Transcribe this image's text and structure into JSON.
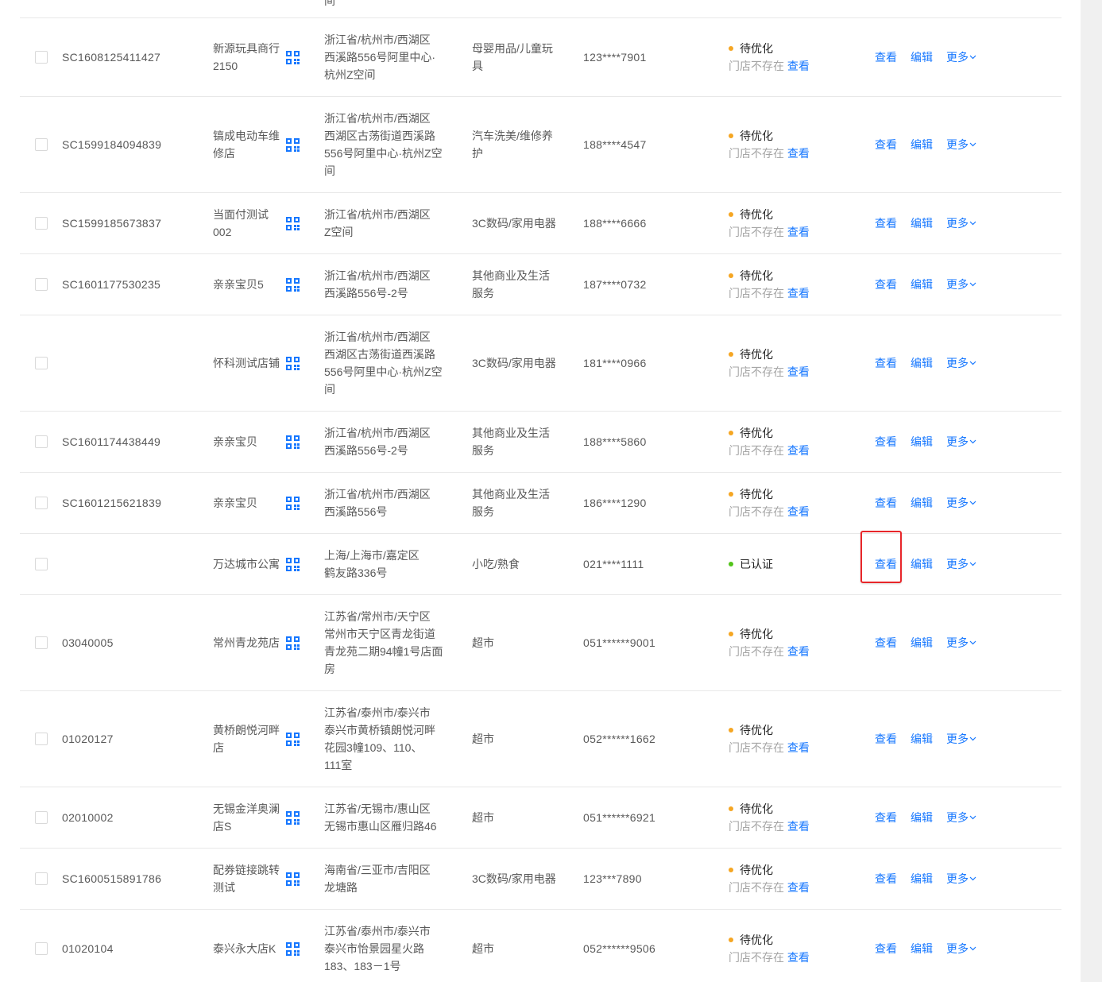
{
  "colors": {
    "link": "#1677ff",
    "pending_dot": "#f5a623",
    "verified_dot": "#52c41a",
    "highlight": "#e8262a",
    "divider": "#e8e8e8"
  },
  "icons": {
    "qr": "qrcode-icon",
    "more": "chevron-down-icon"
  },
  "top_stub_text": "间",
  "labels": {
    "view": "查看",
    "edit": "编辑",
    "more": "更多",
    "store_missing": "门店不存在",
    "store_missing_link": "查看"
  },
  "rows": [
    {
      "id": "SC1608125411427",
      "name": [
        "新源玩具商行",
        "2150"
      ],
      "address": [
        "浙江省/杭州市/西湖区",
        "西溪路556号阿里中心·",
        "杭州Z空间"
      ],
      "category": [
        "母婴用品/儿童玩",
        "具"
      ],
      "phone": "123****7901",
      "status": "待优化",
      "status_type": "pending",
      "note": true
    },
    {
      "id": "SC1599184094839",
      "name": [
        "镐成电动车维",
        "修店"
      ],
      "address": [
        "浙江省/杭州市/西湖区",
        "西湖区古荡街道西溪路",
        "556号阿里中心·杭州Z空",
        "间"
      ],
      "category": [
        "汽车洗美/维修养",
        "护"
      ],
      "phone": "188****4547",
      "status": "待优化",
      "status_type": "pending",
      "note": true
    },
    {
      "id": "SC1599185673837",
      "name": [
        "当面付测试",
        "002"
      ],
      "address": [
        "浙江省/杭州市/西湖区",
        "Z空间"
      ],
      "category": [
        "3C数码/家用电器"
      ],
      "phone": "188****6666",
      "status": "待优化",
      "status_type": "pending",
      "note": true
    },
    {
      "id": "SC1601177530235",
      "name": [
        "亲亲宝贝5"
      ],
      "address": [
        "浙江省/杭州市/西湖区",
        "西溪路556号-2号"
      ],
      "category": [
        "其他商业及生活",
        "服务"
      ],
      "phone": "187****0732",
      "status": "待优化",
      "status_type": "pending",
      "note": true
    },
    {
      "id": "",
      "name": [
        "怀科测试店铺"
      ],
      "address": [
        "浙江省/杭州市/西湖区",
        "西湖区古荡街道西溪路",
        "556号阿里中心·杭州Z空",
        "间"
      ],
      "category": [
        "3C数码/家用电器"
      ],
      "phone": "181****0966",
      "status": "待优化",
      "status_type": "pending",
      "note": true
    },
    {
      "id": "SC1601174438449",
      "name": [
        "亲亲宝贝"
      ],
      "address": [
        "浙江省/杭州市/西湖区",
        "西溪路556号-2号"
      ],
      "category": [
        "其他商业及生活",
        "服务"
      ],
      "phone": "188****5860",
      "status": "待优化",
      "status_type": "pending",
      "note": true
    },
    {
      "id": "SC1601215621839",
      "name": [
        "亲亲宝贝"
      ],
      "address": [
        "浙江省/杭州市/西湖区",
        "西溪路556号"
      ],
      "category": [
        "其他商业及生活",
        "服务"
      ],
      "phone": "186****1290",
      "status": "待优化",
      "status_type": "pending",
      "note": true
    },
    {
      "id": "",
      "name": [
        "万达城市公寓"
      ],
      "address": [
        "上海/上海市/嘉定区",
        "鹤友路336号"
      ],
      "category": [
        "小吃/熟食"
      ],
      "phone": "021****1111",
      "status": "已认证",
      "status_type": "verified",
      "note": false,
      "highlight_view": true
    },
    {
      "id": "03040005",
      "name": [
        "常州青龙苑店"
      ],
      "address": [
        "江苏省/常州市/天宁区",
        "常州市天宁区青龙街道",
        "青龙苑二期94幢1号店面",
        "房"
      ],
      "category": [
        "超市"
      ],
      "phone": "051******9001",
      "status": "待优化",
      "status_type": "pending",
      "note": true
    },
    {
      "id": "01020127",
      "name": [
        "黄桥朗悦河畔",
        "店"
      ],
      "address": [
        "江苏省/泰州市/泰兴市",
        "泰兴市黄桥镇朗悦河畔",
        "花园3幢109、110、",
        "111室"
      ],
      "category": [
        "超市"
      ],
      "phone": "052******1662",
      "status": "待优化",
      "status_type": "pending",
      "note": true
    },
    {
      "id": "02010002",
      "name": [
        "无锡金洋奥澜",
        "店S"
      ],
      "address": [
        "江苏省/无锡市/惠山区",
        "无锡市惠山区雁归路46"
      ],
      "category": [
        "超市"
      ],
      "phone": "051******6921",
      "status": "待优化",
      "status_type": "pending",
      "note": true
    },
    {
      "id": "SC1600515891786",
      "name": [
        "配券链接跳转",
        "测试"
      ],
      "address": [
        "海南省/三亚市/吉阳区",
        "龙塘路"
      ],
      "category": [
        "3C数码/家用电器"
      ],
      "phone": "123***7890",
      "status": "待优化",
      "status_type": "pending",
      "note": true
    },
    {
      "id": "01020104",
      "name": [
        "泰兴永大店K"
      ],
      "address": [
        "江苏省/泰州市/泰兴市",
        "泰兴市怡景园星火路",
        "183、183－1号"
      ],
      "category": [
        "超市"
      ],
      "phone": "052******9506",
      "status": "待优化",
      "status_type": "pending",
      "note": true
    }
  ]
}
